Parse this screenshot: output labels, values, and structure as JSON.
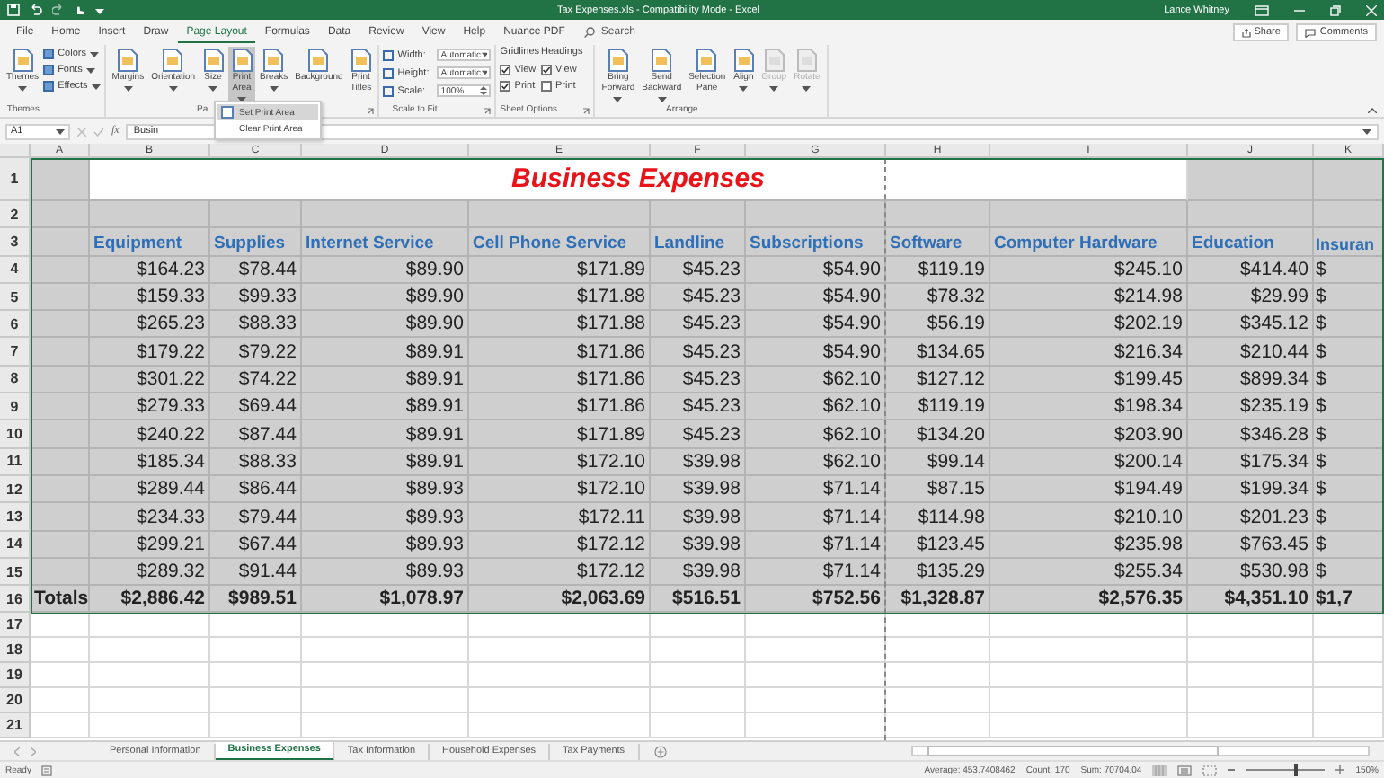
{
  "window": {
    "title": "Tax Expenses.xls  -  Compatibility Mode  -  Excel",
    "user": "Lance Whitney"
  },
  "ribbon_tabs": [
    {
      "label": "File",
      "selected": false
    },
    {
      "label": "Home",
      "selected": false
    },
    {
      "label": "Insert",
      "selected": false
    },
    {
      "label": "Draw",
      "selected": false
    },
    {
      "label": "Page Layout",
      "selected": true
    },
    {
      "label": "Formulas",
      "selected": false
    },
    {
      "label": "Data",
      "selected": false
    },
    {
      "label": "Review",
      "selected": false
    },
    {
      "label": "View",
      "selected": false
    },
    {
      "label": "Help",
      "selected": false
    },
    {
      "label": "Nuance PDF",
      "selected": false
    }
  ],
  "search": {
    "placeholder": "Search"
  },
  "share": "Share",
  "comments": "Comments",
  "ribbon_groups": [
    {
      "label": "Themes",
      "launcher": false,
      "columns": [
        [
          {
            "kind": "large",
            "label": "Themes",
            "dropdown": true,
            "pressed": false,
            "disabled": false
          }
        ],
        [
          {
            "kind": "small",
            "label": "Colors"
          },
          {
            "kind": "small",
            "label": "Fonts"
          },
          {
            "kind": "small",
            "label": "Effects"
          }
        ]
      ]
    },
    {
      "label": "Pa",
      "launcher": true,
      "columns": [
        [
          {
            "kind": "large",
            "label": "Margins",
            "dropdown": true,
            "pressed": false,
            "disabled": false
          }
        ],
        [
          {
            "kind": "large",
            "label": "Orientation",
            "dropdown": true,
            "pressed": false,
            "disabled": false
          }
        ],
        [
          {
            "kind": "large",
            "label": "Size",
            "dropdown": true,
            "pressed": false,
            "disabled": false
          }
        ],
        [
          {
            "kind": "large",
            "label": "Print Area",
            "dropdown": true,
            "pressed": true,
            "disabled": false
          }
        ],
        [
          {
            "kind": "large",
            "label": "Breaks",
            "dropdown": true,
            "pressed": false,
            "disabled": false
          }
        ],
        [
          {
            "kind": "large",
            "label": "Background",
            "dropdown": false,
            "pressed": false,
            "disabled": false
          }
        ],
        [
          {
            "kind": "large",
            "label": "Print Titles",
            "dropdown": false,
            "pressed": false,
            "disabled": false
          }
        ]
      ]
    },
    {
      "label": "Scale to Fit",
      "launcher": true,
      "columns": [
        [
          {
            "kind": "field",
            "label": "Width:",
            "value": "Automatic"
          },
          {
            "kind": "field",
            "label": "Height:",
            "value": "Automatic"
          },
          {
            "kind": "spin",
            "label": "Scale:",
            "value": "100%"
          }
        ]
      ]
    },
    {
      "label": "Sheet Options",
      "launcher": true,
      "columns": [
        [
          {
            "kind": "heading",
            "label": "Gridlines"
          },
          {
            "kind": "check",
            "label": "View",
            "checked": true
          },
          {
            "kind": "check",
            "label": "Print",
            "checked": true
          }
        ],
        [
          {
            "kind": "heading",
            "label": "Headings"
          },
          {
            "kind": "check",
            "label": "View",
            "checked": true
          },
          {
            "kind": "check",
            "label": "Print",
            "checked": false
          }
        ]
      ]
    },
    {
      "label": "Arrange",
      "launcher": false,
      "columns": [
        [
          {
            "kind": "large",
            "label": "Bring Forward",
            "dropdown": true,
            "pressed": false,
            "disabled": false
          }
        ],
        [
          {
            "kind": "large",
            "label": "Send Backward",
            "dropdown": true,
            "pressed": false,
            "disabled": false
          }
        ],
        [
          {
            "kind": "large",
            "label": "Selection Pane",
            "dropdown": false,
            "pressed": false,
            "disabled": false
          }
        ],
        [
          {
            "kind": "large",
            "label": "Align",
            "dropdown": true,
            "pressed": false,
            "disabled": false
          }
        ],
        [
          {
            "kind": "large",
            "label": "Group",
            "dropdown": true,
            "pressed": false,
            "disabled": true
          }
        ],
        [
          {
            "kind": "large",
            "label": "Rotate",
            "dropdown": true,
            "pressed": false,
            "disabled": true
          }
        ]
      ]
    }
  ],
  "menu": {
    "items": [
      {
        "label": "Set Print Area",
        "selected": true
      },
      {
        "label": "Clear Print Area",
        "selected": false
      }
    ]
  },
  "formula_bar": {
    "name_box": "A1",
    "fx": "fx",
    "content": "Busin"
  },
  "sheet": {
    "column_letters": [
      "A",
      "B",
      "C",
      "D",
      "E",
      "F",
      "G",
      "H",
      "I",
      "J",
      "K"
    ],
    "row_numbers": [
      "1",
      "2",
      "3",
      "4",
      "5",
      "6",
      "7",
      "8",
      "9",
      "10",
      "11",
      "12",
      "13",
      "14",
      "15",
      "16",
      "17",
      "18",
      "19",
      "20",
      "21"
    ],
    "title": "Business Expenses",
    "headers": [
      "Equipment",
      "Supplies",
      "Internet Service",
      "Cell Phone Service",
      "Landline",
      "Subscriptions",
      "Software",
      "Computer Hardware",
      "Education",
      "Insuran"
    ],
    "rows": [
      [
        "$164.23",
        "$78.44",
        "$89.90",
        "$171.89",
        "$45.23",
        "$54.90",
        "$119.19",
        "$245.10",
        "$414.40",
        "$"
      ],
      [
        "$159.33",
        "$99.33",
        "$89.90",
        "$171.88",
        "$45.23",
        "$54.90",
        "$78.32",
        "$214.98",
        "$29.99",
        "$"
      ],
      [
        "$265.23",
        "$88.33",
        "$89.90",
        "$171.88",
        "$45.23",
        "$54.90",
        "$56.19",
        "$202.19",
        "$345.12",
        "$"
      ],
      [
        "$179.22",
        "$79.22",
        "$89.91",
        "$171.86",
        "$45.23",
        "$54.90",
        "$134.65",
        "$216.34",
        "$210.44",
        "$"
      ],
      [
        "$301.22",
        "$74.22",
        "$89.91",
        "$171.86",
        "$45.23",
        "$62.10",
        "$127.12",
        "$199.45",
        "$899.34",
        "$"
      ],
      [
        "$279.33",
        "$69.44",
        "$89.91",
        "$171.86",
        "$45.23",
        "$62.10",
        "$119.19",
        "$198.34",
        "$235.19",
        "$"
      ],
      [
        "$240.22",
        "$87.44",
        "$89.91",
        "$171.89",
        "$45.23",
        "$62.10",
        "$134.20",
        "$203.90",
        "$346.28",
        "$"
      ],
      [
        "$185.34",
        "$88.33",
        "$89.91",
        "$172.10",
        "$39.98",
        "$62.10",
        "$99.14",
        "$200.14",
        "$175.34",
        "$"
      ],
      [
        "$289.44",
        "$86.44",
        "$89.93",
        "$172.10",
        "$39.98",
        "$71.14",
        "$87.15",
        "$194.49",
        "$199.34",
        "$"
      ],
      [
        "$234.33",
        "$79.44",
        "$89.93",
        "$172.11",
        "$39.98",
        "$71.14",
        "$114.98",
        "$210.10",
        "$201.23",
        "$"
      ],
      [
        "$299.21",
        "$67.44",
        "$89.93",
        "$172.12",
        "$39.98",
        "$71.14",
        "$123.45",
        "$235.98",
        "$763.45",
        "$"
      ],
      [
        "$289.32",
        "$91.44",
        "$89.93",
        "$172.12",
        "$39.98",
        "$71.14",
        "$135.29",
        "$255.34",
        "$530.98",
        "$"
      ]
    ],
    "totals": {
      "label": "Totals",
      "values": [
        "$2,886.42",
        "$989.51",
        "$1,078.97",
        "$2,063.69",
        "$516.51",
        "$752.56",
        "$1,328.87",
        "$2,576.35",
        "$4,351.10",
        "$1,7"
      ]
    }
  },
  "sheet_tabs": [
    {
      "label": "Personal Information",
      "selected": false
    },
    {
      "label": "Business Expenses",
      "selected": true
    },
    {
      "label": "Tax Information",
      "selected": false
    },
    {
      "label": "Household Expenses",
      "selected": false
    },
    {
      "label": "Tax Payments",
      "selected": false
    }
  ],
  "status": {
    "mode": "Ready",
    "average": "Average: 453.7408462",
    "count": "Count: 170",
    "sum": "Sum: 70704.04",
    "zoom": {
      "level": 0.6,
      "reading": "150%"
    }
  }
}
